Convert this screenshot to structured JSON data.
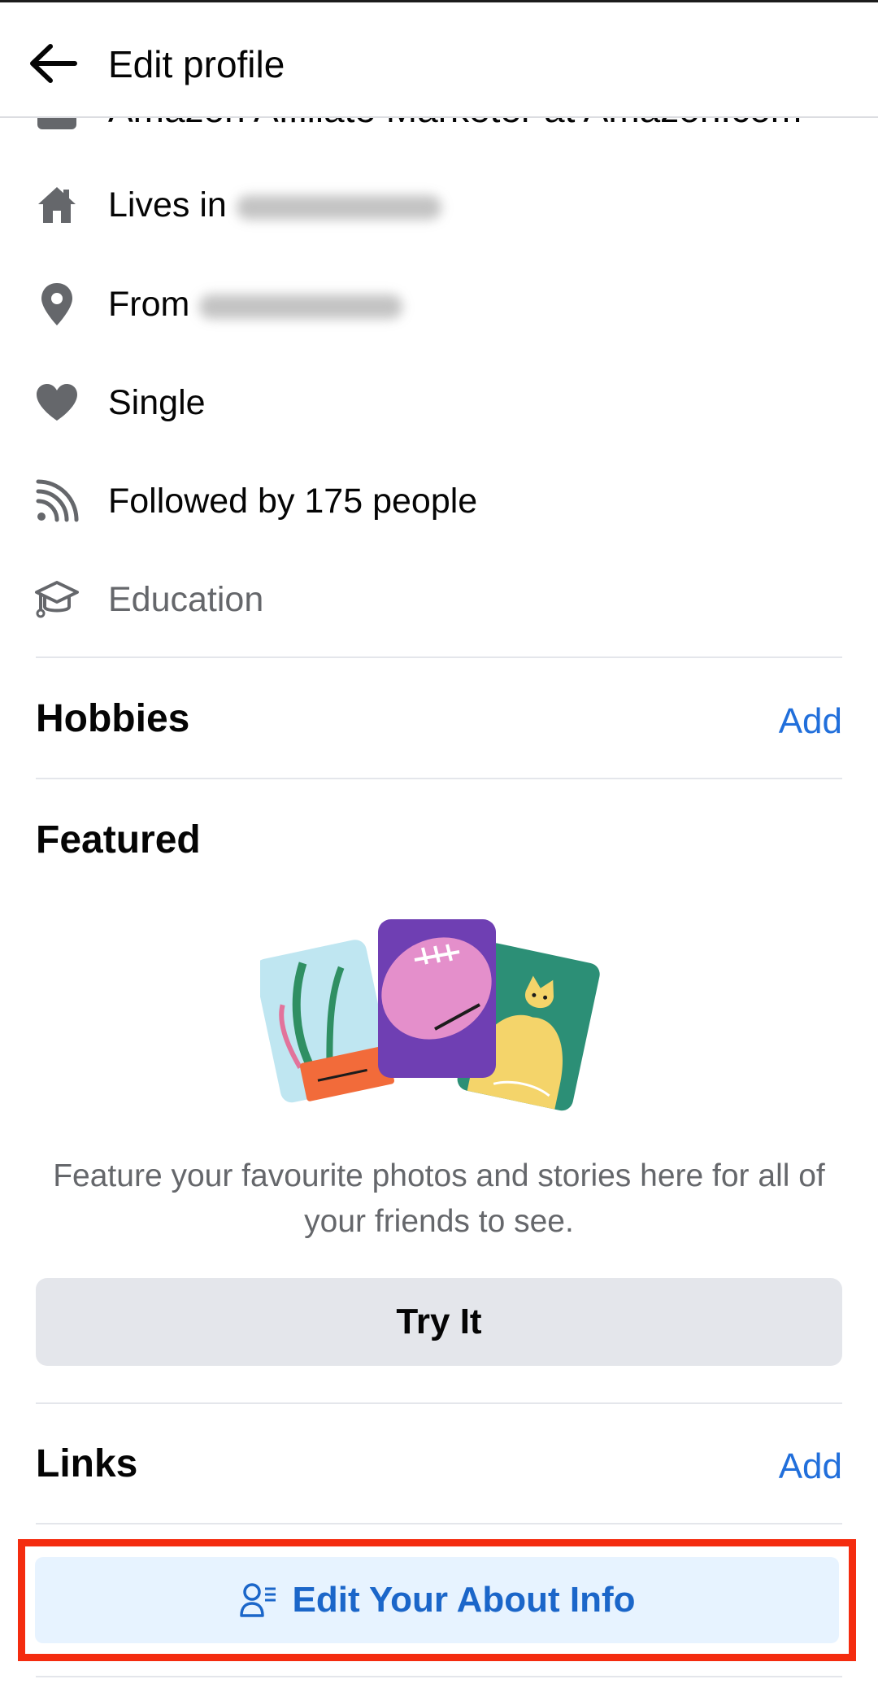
{
  "header": {
    "title": "Edit profile",
    "back_icon": "arrow-left-icon"
  },
  "details": {
    "partial_row": "Amazon Affiliate Marketer at Amazon.com",
    "items": [
      {
        "icon": "house-icon",
        "prefix": "Lives in",
        "value_hidden": true
      },
      {
        "icon": "location-pin-icon",
        "prefix": "From",
        "value_hidden": true
      },
      {
        "icon": "heart-icon",
        "label": "Single"
      },
      {
        "icon": "rss-feed-icon",
        "label": "Followed by 175 people"
      },
      {
        "icon": "graduation-cap-icon",
        "label": "Education"
      }
    ]
  },
  "hobbies": {
    "title": "Hobbies",
    "add_label": "Add"
  },
  "featured": {
    "title": "Featured",
    "description": "Feature your favourite photos and stories here for all of your friends to see.",
    "button_label": "Try It"
  },
  "links": {
    "title": "Links",
    "add_label": "Add"
  },
  "edit_about": {
    "label": "Edit Your About Info",
    "icon": "person-list-icon"
  },
  "colors": {
    "accent": "#216fdb",
    "highlight_border": "#f42c0f",
    "button_bg": "#e4e6eb",
    "edit_about_bg": "#e7f3ff"
  }
}
